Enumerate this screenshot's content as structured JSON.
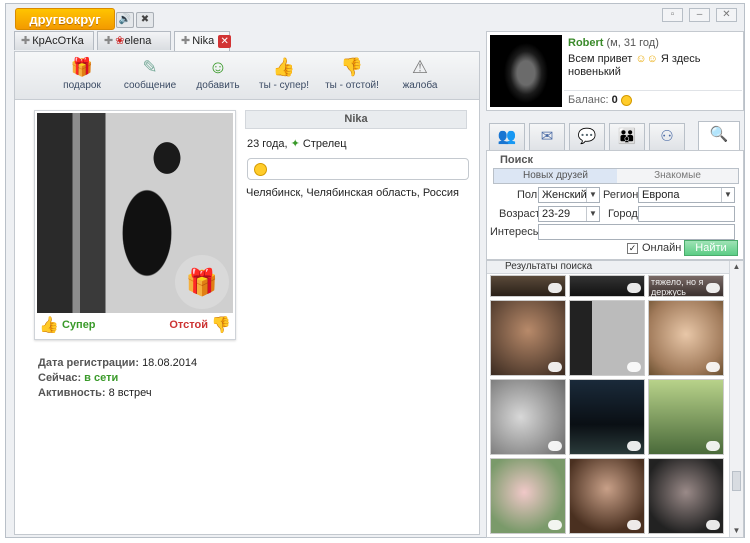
{
  "app": {
    "logo": "другвокруг"
  },
  "icons": {
    "sound": "speaker-icon",
    "settings": "tools-icon",
    "restore": "restore-icon",
    "minimize": "minimize-icon",
    "close": "close-icon"
  },
  "tabs": [
    {
      "label": "КрАсОтКа"
    },
    {
      "label": "elena"
    },
    {
      "label": "Nika",
      "active": true
    }
  ],
  "toolbar": {
    "gift": "подарок",
    "message": "сообщение",
    "add": "добавить",
    "super": "ты - супер!",
    "bad": "ты - отстой!",
    "complaint": "жалоба"
  },
  "profile": {
    "name": "Nika",
    "age_sign": "23 года,",
    "zodiac": "Стрелец",
    "location": "Челябинск, Челябинская область, Россия",
    "vote_super": "Супер",
    "vote_bad": "Отстой",
    "reg_label": "Дата регистрации:",
    "reg_value": "18.08.2014",
    "now_label": "Сейчас:",
    "now_value": "в сети",
    "activity_label": "Активность:",
    "activity_value": "8 встреч"
  },
  "user": {
    "name": "Robert",
    "meta": "(м, 31 год)",
    "status_a": "Всем привет",
    "status_b": "Я здесь новенький",
    "balance_label": "Баланс:",
    "balance_value": "0"
  },
  "search": {
    "title": "Поиск",
    "seg_new": "Новых друзей",
    "seg_known": "Знакомые",
    "sex_label": "Пол",
    "sex_value": "Женский",
    "region_label": "Регион",
    "region_value": "Европа",
    "age_label": "Возраст",
    "age_value": "23-29",
    "city_label": "Город",
    "city_value": "",
    "interests_label": "Интересы",
    "interests_value": "",
    "online_label": "Онлайн",
    "online_checked": true,
    "find_button": "Найти"
  },
  "results": {
    "header": "Результаты поиска",
    "top_caption": "тяжело, но я держусь"
  },
  "colors": {
    "accent": "#f39a00",
    "green": "#3a9a2a",
    "find": "#5ccd85"
  }
}
